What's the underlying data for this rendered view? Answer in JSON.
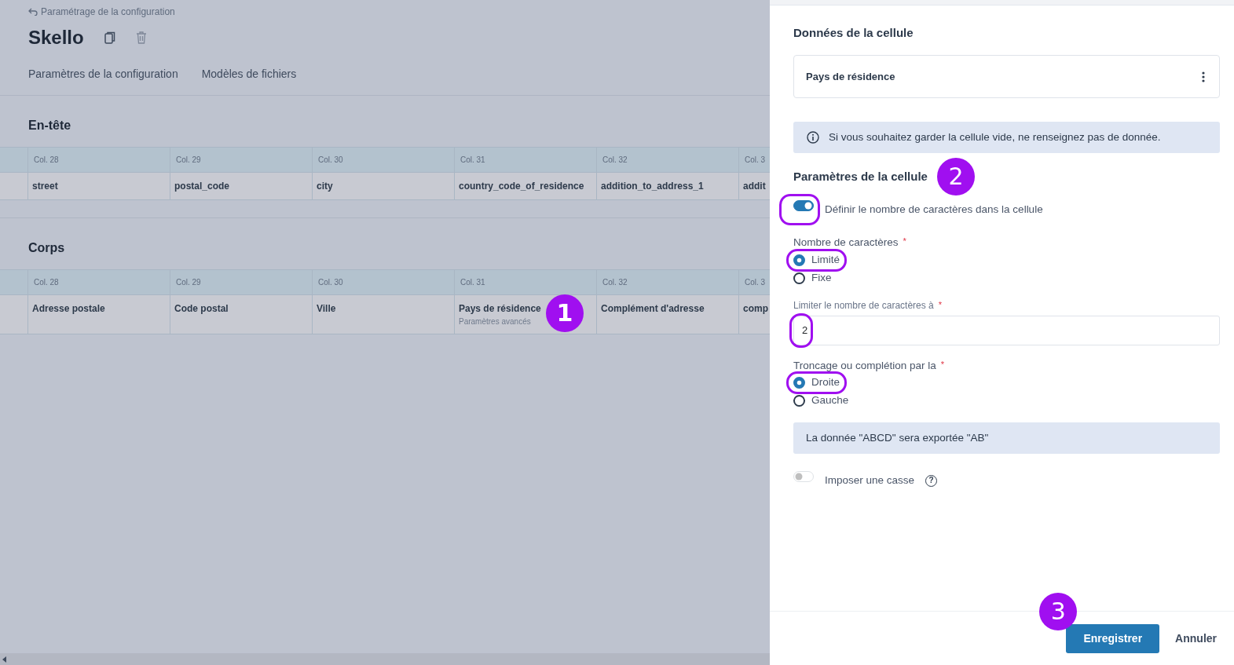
{
  "breadcrumb": {
    "label": "Paramétrage de la configuration"
  },
  "title": "Skello",
  "tabs": [
    {
      "label": "Paramètres de la configuration"
    },
    {
      "label": "Modèles de fichiers"
    }
  ],
  "sections": [
    {
      "title": "En-tête",
      "columns": [
        "Col. 28",
        "Col. 29",
        "Col. 30",
        "Col. 31",
        "Col. 32",
        "Col. 3"
      ],
      "rows": [
        [
          {
            "text": "street"
          },
          {
            "text": "postal_code"
          },
          {
            "text": "city"
          },
          {
            "text": "country_code_of_residence"
          },
          {
            "text": "addition_to_address_1"
          },
          {
            "text": "addit"
          }
        ]
      ]
    },
    {
      "title": "Corps",
      "columns": [
        "Col. 28",
        "Col. 29",
        "Col. 30",
        "Col. 31",
        "Col. 32",
        "Col. 3"
      ],
      "rows": [
        [
          {
            "text": "Adresse postale"
          },
          {
            "text": "Code postal"
          },
          {
            "text": "Ville"
          },
          {
            "text": "Pays de résidence",
            "subtext": "Paramètres avancés",
            "marker": "1"
          },
          {
            "text": "Complément d'adresse"
          },
          {
            "text": "comp"
          }
        ]
      ]
    }
  ],
  "panel": {
    "data_title": "Données de la cellule",
    "data_value": "Pays de résidence",
    "info": "Si vous souhaitez garder la cellule vide, ne renseignez pas de donnée.",
    "settings_title": "Paramètres de la cellule",
    "settings_marker": "2",
    "fields": [
      {
        "kind": "switch",
        "label": "Définir le nombre de caractères dans la cellule",
        "on": true,
        "highlighted": true
      },
      {
        "kind": "radio_group",
        "label": "Nombre de caractères",
        "required_mark": "*",
        "options": [
          {
            "label": "Limité",
            "selected": true,
            "highlighted": true
          },
          {
            "label": "Fixe",
            "selected": false
          }
        ]
      },
      {
        "kind": "input",
        "label": "Limiter le nombre de caractères à",
        "required_mark": "*",
        "value": "2",
        "highlighted": true
      },
      {
        "kind": "radio_group",
        "label": "Troncage ou complétion par la",
        "required_mark": "*",
        "options": [
          {
            "label": "Droite",
            "selected": true,
            "highlighted": true
          },
          {
            "label": "Gauche",
            "selected": false
          }
        ]
      },
      {
        "kind": "note",
        "text": "La donnée \"ABCD\" sera exportée \"AB\""
      },
      {
        "kind": "switch",
        "label": "Imposer une casse",
        "on": false,
        "help": "?"
      }
    ]
  },
  "footer": {
    "buttons": [
      {
        "label": "Enregistrer",
        "kind": "primary",
        "marker": "3"
      },
      {
        "label": "Annuler",
        "kind": "link"
      }
    ]
  }
}
